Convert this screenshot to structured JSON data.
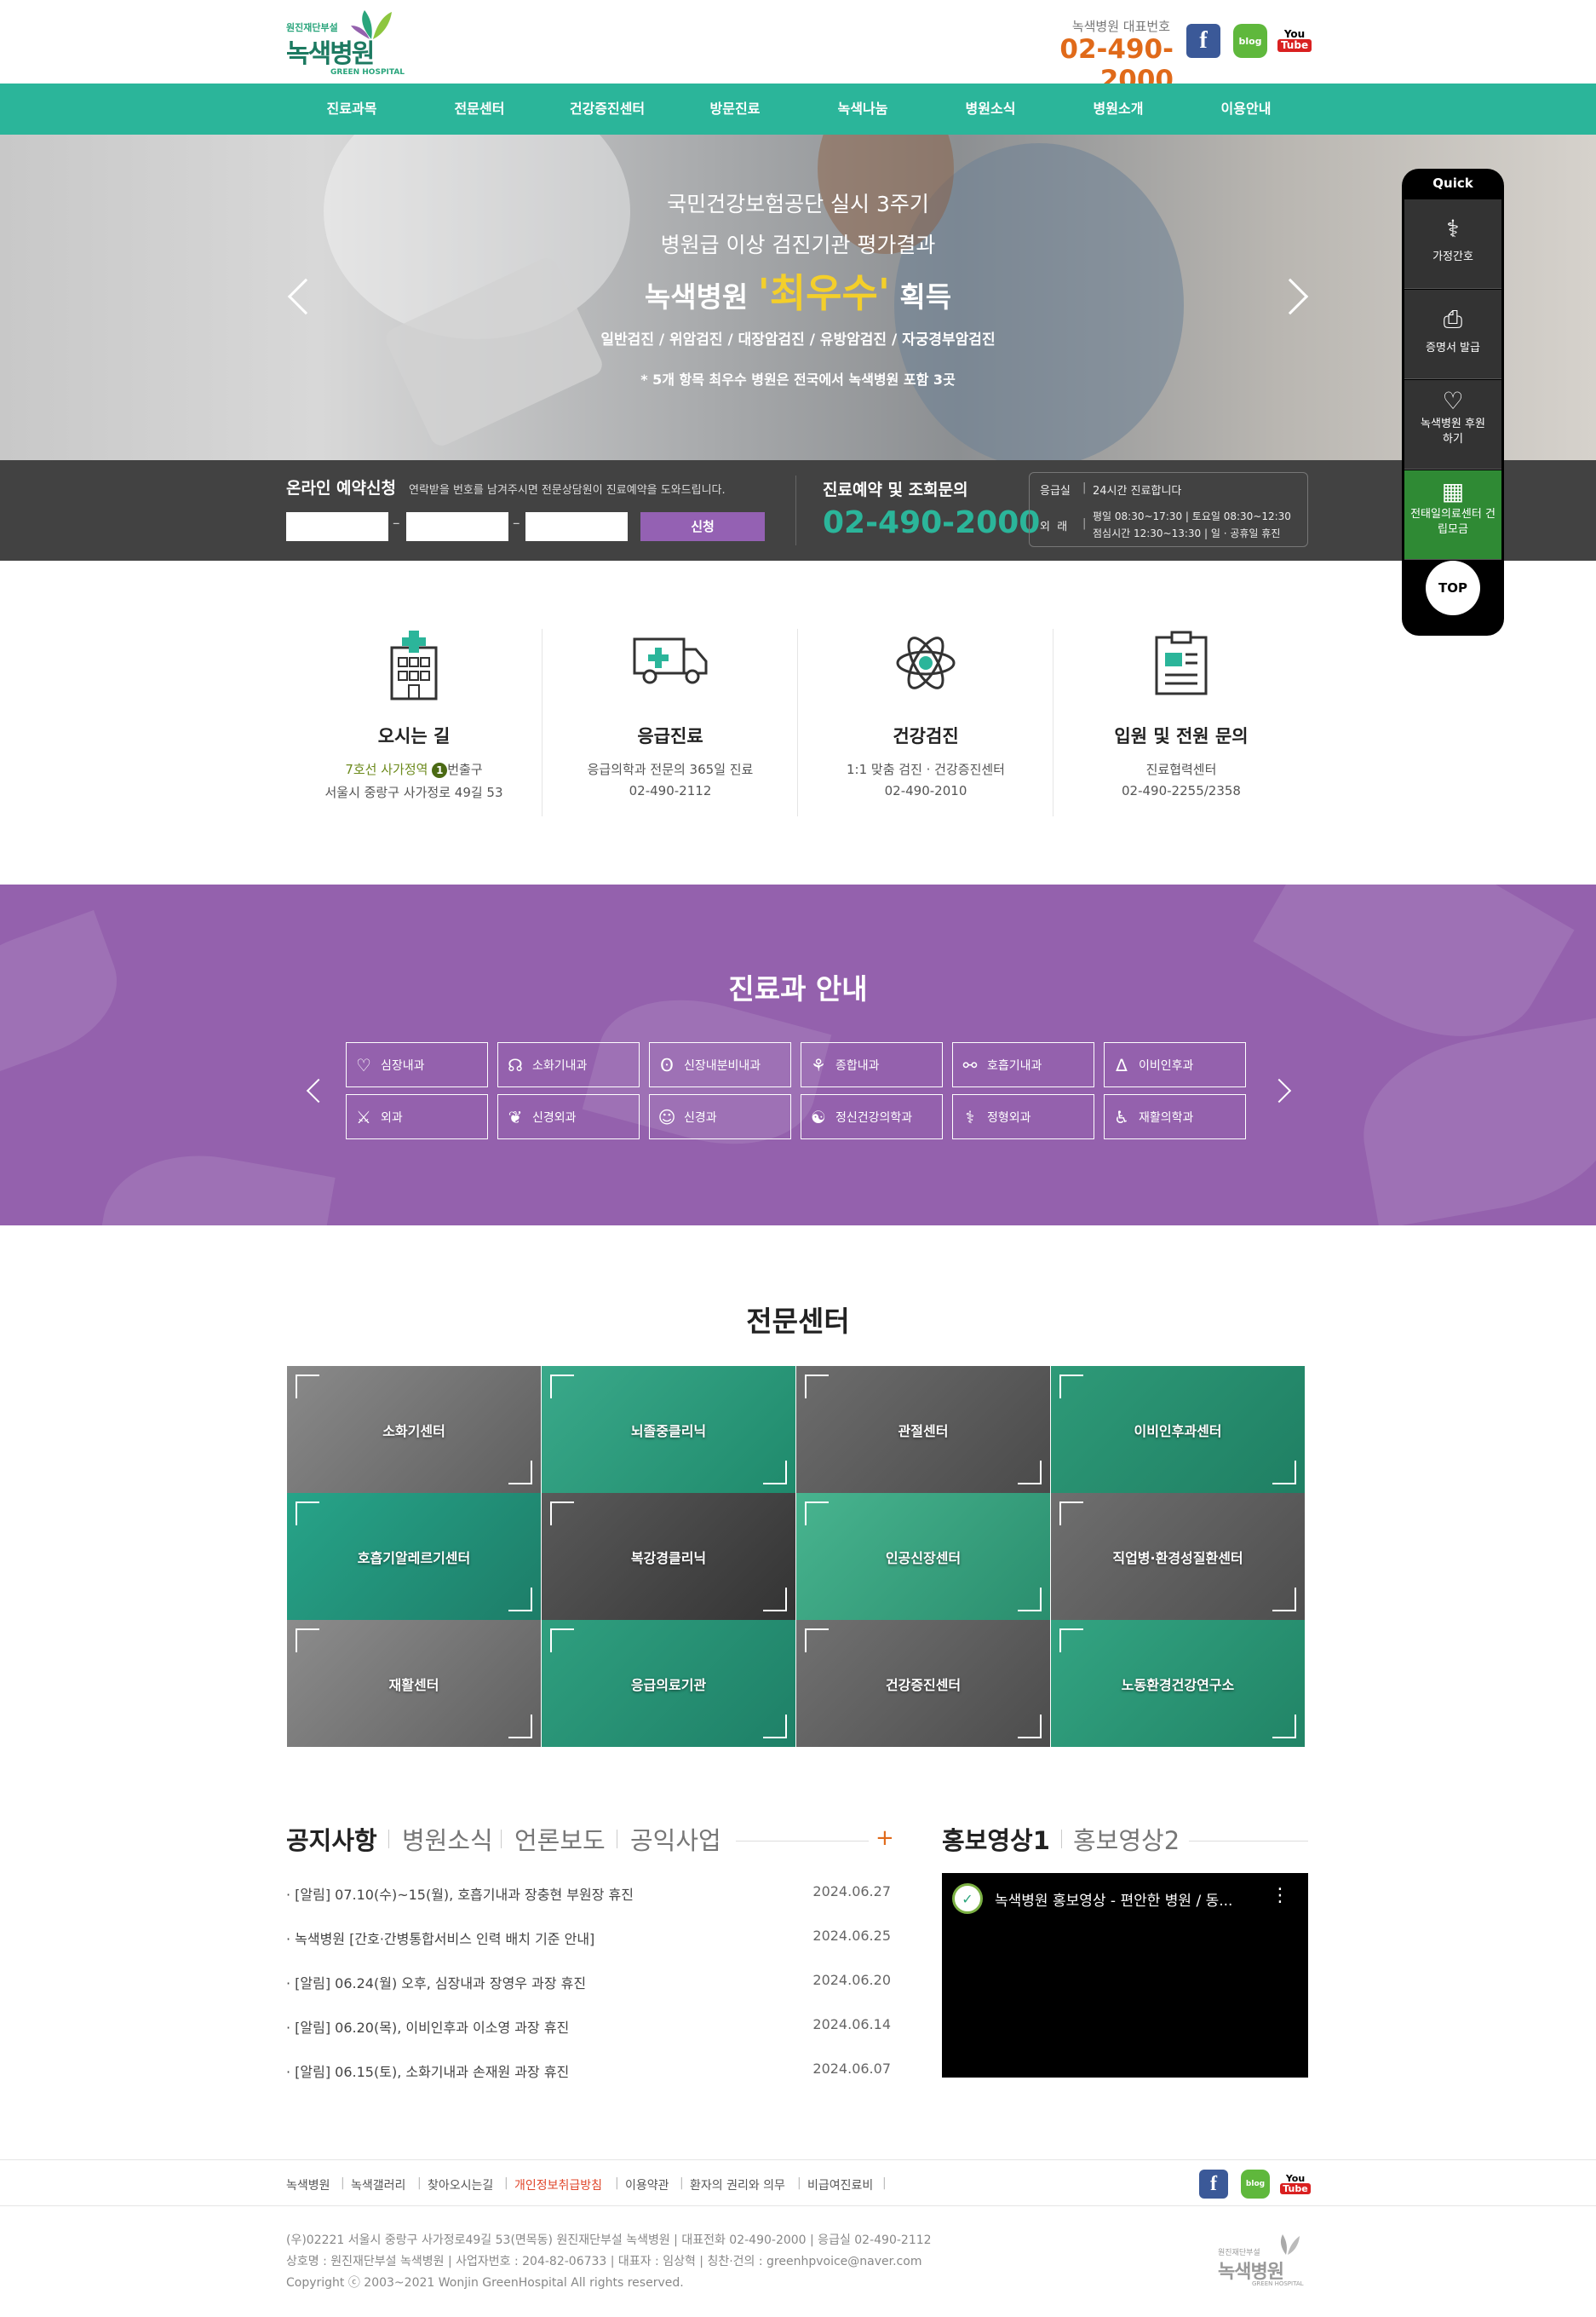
{
  "header": {
    "logo_small": "원진재단부설",
    "logo_name": "녹색병원",
    "logo_eng": "GREEN HOSPITAL",
    "rep_label": "녹색병원 대표번호",
    "rep_phone": "02-490-2000",
    "social": [
      "f",
      "blog",
      "You Tube"
    ]
  },
  "gnb": [
    "진료과목",
    "전문센터",
    "건강증진센터",
    "방문진료",
    "녹색나눔",
    "병원소식",
    "병원소개",
    "이용안내"
  ],
  "hero": {
    "line1": "국민건강보험공단 실시 3주기",
    "line2": "병원급 이상 검진기관 평가결과",
    "line3_pre": "녹색병원",
    "line3_highlight": "'최우수'",
    "line3_post": "획득",
    "line4": "일반검진 / 위암검진 / 대장암검진 / 유방암검진 / 자궁경부암검진",
    "line5": "* 5개 항목 최우수 병원은 전국에서 녹색병원 포함 3곳"
  },
  "reservation": {
    "title": "온라인 예약신청",
    "desc": "연락받을 번호를 남겨주시면 전문상담원이 진료예약을 도와드립니다.",
    "dash": "–",
    "submit": "신청",
    "inquiry_title": "진료예약 및 조회문의",
    "inquiry_phone": "02-490-2000",
    "emergency_label": "응급실",
    "emergency_value": "24시간 진료합니다",
    "outpatient_label": "외  래",
    "outpatient_line1": "평일 08:30~17:30 | 토요일 08:30~12:30",
    "outpatient_line2": "점심시간 12:30~13:30 | 일 · 공휴일 휴진"
  },
  "quick": {
    "title": "Quick",
    "items": [
      {
        "label": "가정간호",
        "icon": "nurse-icon"
      },
      {
        "label": "증명서 발급",
        "icon": "printer-icon"
      },
      {
        "label": "녹색병원 후원하기",
        "icon": "donate-icon"
      },
      {
        "label": "전태일의료센터 건립모금",
        "icon": "building-icon"
      }
    ],
    "top": "TOP"
  },
  "quick_links": [
    {
      "title": "오시는 길",
      "line1_highlight": "7호선 사가정역",
      "line1_badge": "1",
      "line1_post": "번출구",
      "line2": "서울시 중랑구 사가정로 49길 53",
      "icon": "hospital-icon"
    },
    {
      "title": "응급진료",
      "line1": "응급의학과 전문의 365일 진료",
      "line2": "02-490-2112",
      "icon": "ambulance-icon"
    },
    {
      "title": "건강검진",
      "line1": "1:1 맞춤 검진 · 건강증진센터",
      "line2": "02-490-2010",
      "icon": "atom-icon"
    },
    {
      "title": "입원 및 전원 문의",
      "line1": "진료협력센터",
      "line2": "02-490-2255/2358",
      "icon": "clipboard-icon"
    }
  ],
  "departments": {
    "title": "진료과 안내",
    "items": [
      "심장내과",
      "소화기내과",
      "신장내분비내과",
      "종합내과",
      "호흡기내과",
      "이비인후과",
      "외과",
      "신경외과",
      "신경과",
      "정신건강의학과",
      "정형외과",
      "재활의학과"
    ]
  },
  "centers": {
    "title": "전문센터",
    "items": [
      "소화기센터",
      "뇌졸중클리닉",
      "관절센터",
      "이비인후과센터",
      "호흡기알레르기센터",
      "복강경클리닉",
      "인공신장센터",
      "직업병·환경성질환센터",
      "재활센터",
      "응급의료기관",
      "건강증진센터",
      "노동환경건강연구소"
    ]
  },
  "notice": {
    "tabs": [
      "공지사항",
      "병원소식",
      "언론보도",
      "공익사업"
    ],
    "more": "+",
    "items": [
      {
        "title": "· [알림] 07.10(수)~15(월), 호흡기내과 장충현 부원장 휴진",
        "date": "2024.06.27"
      },
      {
        "title": "· 녹색병원 [간호·간병통합서비스 인력 배치 기준 안내]",
        "date": "2024.06.25"
      },
      {
        "title": "· [알림] 06.24(월) 오후, 심장내과 장영우 과장 휴진",
        "date": "2024.06.20"
      },
      {
        "title": "· [알림] 06.20(목), 이비인후과 이소영 과장 휴진",
        "date": "2024.06.14"
      },
      {
        "title": "· [알림] 06.15(토), 소화기내과 손재원 과장 휴진",
        "date": "2024.06.07"
      }
    ]
  },
  "video": {
    "tabs": [
      "홍보영상1",
      "홍보영상2"
    ],
    "title": "녹색병원 홍보영상 - 편안한 병원 / 동...",
    "menu": "⋮"
  },
  "footer": {
    "links": [
      "녹색병원",
      "녹색갤러리",
      "찾아오시는길",
      "개인정보취급방침",
      "이용약관",
      "환자의 권리와 의무",
      "비급여진료비"
    ],
    "sep": "|",
    "highlight_color": "#e0462a",
    "info1": "(우)02221 서울시 중랑구 사가정로49길 53(면목동) 원진재단부설 녹색병원 | 대표전화 02-490-2000 | 응급실 02-490-2112",
    "info2": "상호명 : 원진재단부설 녹색병원 | 사업자번호 : 204-82-06733 | 대표자 : 임상혁 | 칭찬·건의 : greenhpvoice@naver.com",
    "info3": "Copyright ⓒ 2003~2021 Wonjin GreenHospital All rights reserved.",
    "logo_small": "원진재단부설",
    "logo_name": "녹색병원",
    "logo_eng": "GREEN HOSPITAL"
  },
  "colors": {
    "primary": "#2bb59a",
    "purple": "#9461ad",
    "orange": "#e06a1a",
    "dark": "#424242"
  }
}
